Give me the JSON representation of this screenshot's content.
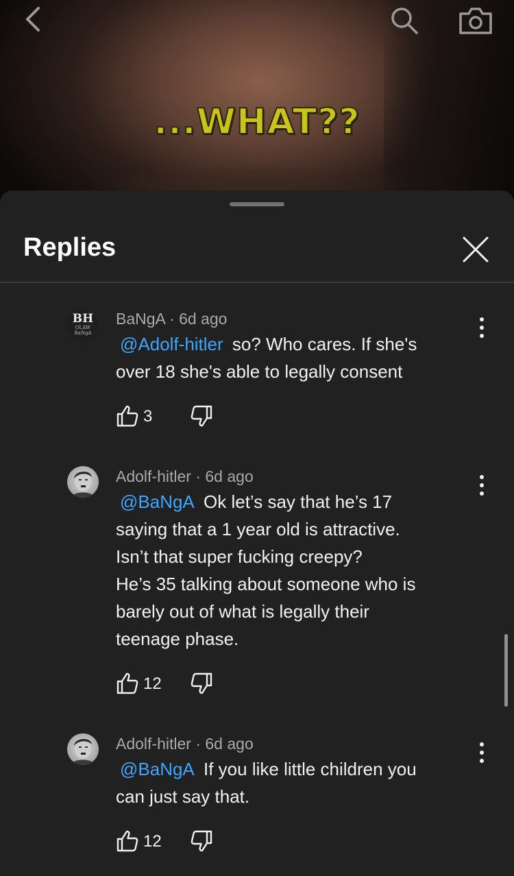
{
  "video": {
    "caption": "...WHAT??"
  },
  "sheet": {
    "title": "Replies"
  },
  "comments": [
    {
      "author": "BaNgA",
      "age": "6d ago",
      "avatar_text": {
        "main": "BH",
        "sub": "OLAW BaNgA"
      },
      "mention": "@Adolf-hitler",
      "lines": [
        "so? Who cares. If she's",
        "over 18 she's able to legally consent"
      ],
      "likes": "3"
    },
    {
      "author": "Adolf-hitler",
      "age": "6d ago",
      "mention": "@BaNgA",
      "lines": [
        "Ok let’s say that he’s 17",
        "saying that a 1 year old is attractive.",
        "Isn’t that super fucking creepy?",
        "He’s 35 talking about someone who is",
        "barely out of what is legally their",
        "teenage phase."
      ],
      "likes": "12"
    },
    {
      "author": "Adolf-hitler",
      "age": "6d ago",
      "mention": "@BaNgA",
      "lines": [
        "If you like little children you",
        "can just say that."
      ],
      "likes": "12"
    }
  ],
  "icons": {
    "back": "chevron-left-icon",
    "search": "search-icon",
    "camera": "camera-icon",
    "close": "close-icon",
    "more": "more-vertical-icon",
    "like": "thumbs-up-icon",
    "dislike": "thumbs-down-icon"
  },
  "colors": {
    "mention": "#3ea6ff",
    "sheet_bg": "#212121",
    "caption": "#c9c31a"
  }
}
